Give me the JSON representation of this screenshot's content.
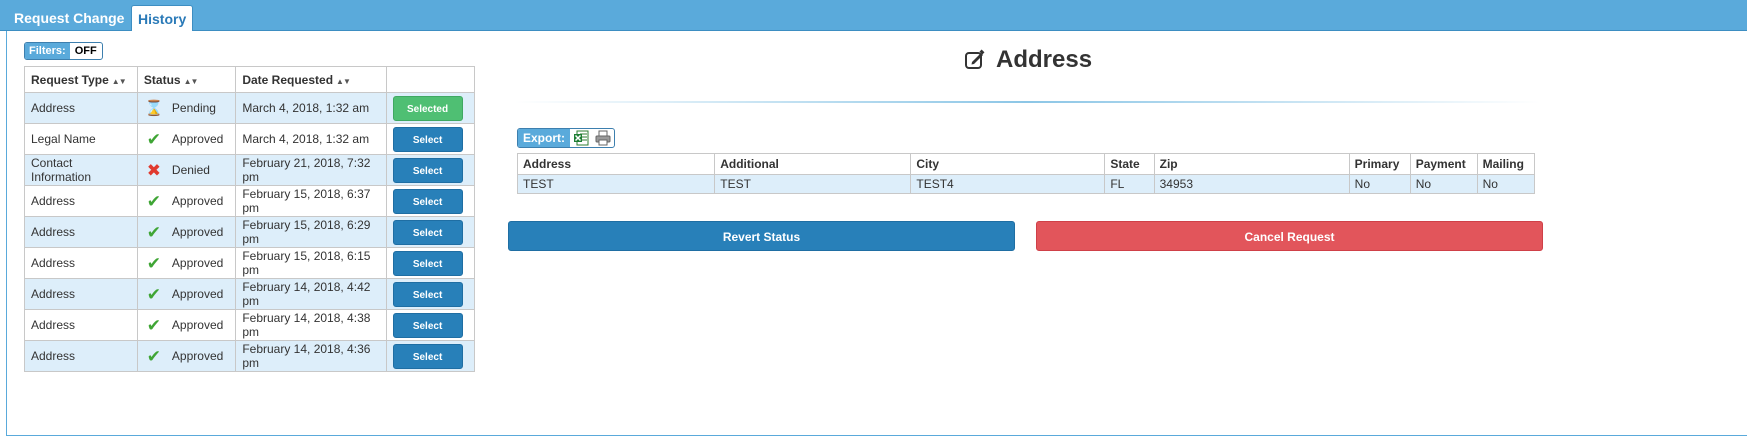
{
  "tabs": [
    {
      "label": "Request Change"
    },
    {
      "label": "History"
    }
  ],
  "filters": {
    "label": "Filters:",
    "state": "OFF"
  },
  "requests_table": {
    "headers": [
      "Request Type",
      "Status",
      "Date Requested",
      ""
    ],
    "rows": [
      {
        "type": "Address",
        "status": "Pending",
        "status_icon": "hourglass-icon",
        "date": "March 4, 2018, 1:32 am",
        "button": "Selected"
      },
      {
        "type": "Legal Name",
        "status": "Approved",
        "status_icon": "checkmark-icon",
        "date": "March 4, 2018, 1:32 am",
        "button": "Select"
      },
      {
        "type": "Contact Information",
        "status": "Denied",
        "status_icon": "red-x-icon",
        "date": "February 21, 2018, 7:32 pm",
        "button": "Select"
      },
      {
        "type": "Address",
        "status": "Approved",
        "status_icon": "checkmark-icon",
        "date": "February 15, 2018, 6:37 pm",
        "button": "Select"
      },
      {
        "type": "Address",
        "status": "Approved",
        "status_icon": "checkmark-icon",
        "date": "February 15, 2018, 6:29 pm",
        "button": "Select"
      },
      {
        "type": "Address",
        "status": "Approved",
        "status_icon": "checkmark-icon",
        "date": "February 15, 2018, 6:15 pm",
        "button": "Select"
      },
      {
        "type": "Address",
        "status": "Approved",
        "status_icon": "checkmark-icon",
        "date": "February 14, 2018, 4:42 pm",
        "button": "Select"
      },
      {
        "type": "Address",
        "status": "Approved",
        "status_icon": "checkmark-icon",
        "date": "February 14, 2018, 4:38 pm",
        "button": "Select"
      },
      {
        "type": "Address",
        "status": "Approved",
        "status_icon": "checkmark-icon",
        "date": "February 14, 2018, 4:36 pm",
        "button": "Select"
      }
    ]
  },
  "detail": {
    "title": "Address",
    "title_icon": "edit-icon",
    "export_label": "Export:",
    "export_icons": [
      "excel-icon",
      "print-icon"
    ],
    "table": {
      "headers": [
        "Address",
        "Additional",
        "City",
        "State",
        "Zip",
        "Primary",
        "Payment",
        "Mailing"
      ],
      "rows": [
        [
          "TEST",
          "TEST",
          "TEST4",
          "FL",
          "34953",
          "No",
          "No",
          "No"
        ]
      ]
    },
    "revert_label": "Revert Status",
    "cancel_label": "Cancel Request"
  },
  "colors": {
    "header_bar": "#5aaadb",
    "button_blue": "#2880b9",
    "button_green": "#4fbf73",
    "button_red": "#e2555b",
    "row_highlight": "#ddeefa"
  }
}
